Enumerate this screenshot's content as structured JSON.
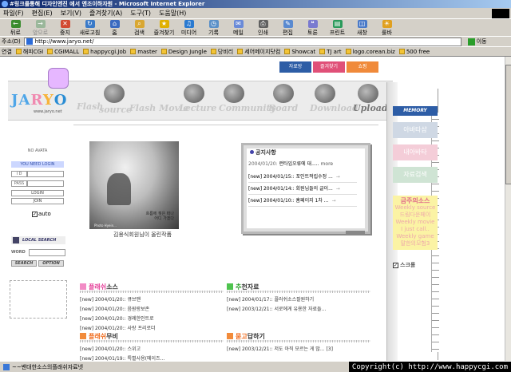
{
  "window": {
    "title": "#링크를통해 디자인엔진 에서 엔조이하자원 - Microsoft Internet Explorer"
  },
  "menu": [
    "파일(F)",
    "편집(E)",
    "보기(V)",
    "즐겨찾기(A)",
    "도구(T)",
    "도움말(H)"
  ],
  "toolbar": [
    {
      "label": "뒤로",
      "color": "#3a8c2e",
      "glyph": "←",
      "icon": "back-arrow-icon"
    },
    {
      "label": "앞으로",
      "color": "#9ab79a",
      "glyph": "→",
      "icon": "forward-arrow-icon",
      "dim": true
    },
    {
      "label": "중지",
      "color": "#d24a32",
      "glyph": "✕",
      "icon": "stop-icon"
    },
    {
      "label": "새로고침",
      "color": "#3a7ac8",
      "glyph": "↻",
      "icon": "refresh-icon"
    },
    {
      "label": "홈",
      "color": "#3a6ac0",
      "glyph": "⌂",
      "icon": "home-icon"
    },
    {
      "label": "검색",
      "color": "#d9a732",
      "glyph": "⌕",
      "icon": "search-icon"
    },
    {
      "label": "즐겨찾기",
      "color": "#e0b000",
      "glyph": "★",
      "icon": "favorites-star-icon"
    },
    {
      "label": "미디어",
      "color": "#2a7ad0",
      "glyph": "♫",
      "icon": "media-icon"
    },
    {
      "label": "기록",
      "color": "#5a90c8",
      "glyph": "◷",
      "icon": "history-icon"
    },
    {
      "label": "메일",
      "color": "#6a8ad8",
      "glyph": "✉",
      "icon": "mail-icon"
    },
    {
      "label": "인쇄",
      "color": "#606060",
      "glyph": "⎙",
      "icon": "print-icon"
    },
    {
      "label": "편집",
      "color": "#5a8ad0",
      "glyph": "✎",
      "icon": "edit-icon"
    },
    {
      "label": "토론",
      "color": "#7a7ad0",
      "glyph": "❝",
      "icon": "discuss-icon"
    },
    {
      "label": "프린트",
      "color": "#2a9a5a",
      "glyph": "▤",
      "icon": "printer-icon"
    },
    {
      "label": "새창",
      "color": "#4a7ac8",
      "glyph": "◫",
      "icon": "new-window-icon"
    },
    {
      "label": "룰바",
      "color": "#e0a020",
      "glyph": "☀",
      "icon": "bulb-icon"
    }
  ],
  "address": {
    "label": "주소(D)",
    "url": "http://www.jaryo.net/",
    "go": "이동"
  },
  "links": {
    "label": "연결",
    "items": [
      "해피CGI",
      "CGIMALL",
      "happycgi.Job",
      "master",
      "Design Jungle",
      "당비리",
      "세어메이지닷컴",
      "Showcat",
      "TJ art",
      "logo.corean.biz",
      "500 free"
    ]
  },
  "top_tabs": [
    {
      "label": "자료방",
      "color": "#2d5da6",
      "strip": "#2d5da6"
    },
    {
      "label": "즐겨찾기",
      "color": "#e05078",
      "strip": "#e05078"
    },
    {
      "label": "쇼핑",
      "color": "#f08a3a",
      "strip": "#f08a3a"
    }
  ],
  "logo": {
    "c1": "JA",
    "c2": "R",
    "c3": "Y",
    "c4": "O",
    "sub": "www.jaryo.net"
  },
  "nav": [
    "Flash",
    "source",
    "Flash Movie",
    "Lecture",
    "Community",
    "Board",
    "Download",
    "Upload"
  ],
  "memory": {
    "head": "MEMORY",
    "buttons": [
      "아바타샵",
      "내아바타",
      "자료검색"
    ],
    "note_title": "금주의소스",
    "note_lines": [
      "Weekly source",
      "드림다운페이",
      "Weekly movie",
      "I just call..",
      "Weekly game",
      "말한의모험3"
    ],
    "scroll_label": "스크롤",
    "scroll_checked": "✓"
  },
  "login": {
    "avatar_caption": "NO AVATA",
    "need_login": "YOU NEED LOGIN",
    "id_label": "I D",
    "pass_label": "PASS",
    "login_btn": "LOGIN",
    "join_btn": "JOIN",
    "auto_label": "auto",
    "auto_checked": "✓"
  },
  "search": {
    "title": "LOCAL SEARCH",
    "word_label": "WORD",
    "search_btn": "SEARCH",
    "option_btn": "OPTION"
  },
  "photo": {
    "caption": "김용식회원님이 올린작품",
    "poem": "흐름에 젖은 떠나\n어디 가겠다",
    "brand": "Photo Hyein..."
  },
  "notice": {
    "title": "공지사항",
    "first_date": "2004/01/20:",
    "first_title": "런타임오류에 대.....",
    "first_more": "more",
    "items": [
      "[new] 2004/01/15:: 포인트적립수정 ...",
      "[new] 2004/01/14:: 회원님들의 글이...",
      "[new] 2004/01/10:: 홈페이지 1차 ..."
    ],
    "go": "→"
  },
  "sections": {
    "flash_source": {
      "title_a": "플래쉬",
      "title_b": "소스",
      "items": [
        "[new] 2004/01/20:: 큐브맨",
        "[new] 2004/01/20:: 음원랑보존",
        "[new] 2004/01/20:: 경례한인트로",
        "[new] 2004/01/20:: 사랑 프리로더"
      ]
    },
    "recommended": {
      "title_a": "추",
      "title_b": "천자료",
      "items": [
        "[new] 2004/01/17:: 플러쉬소스팔원하기",
        "[new] 2003/12/21:: 서로에게 유용한 자료들..."
      ]
    },
    "flash_movie": {
      "title_a": "플래쉬",
      "title_b": "무비",
      "items": [
        "[new] 2004/01/20:: 스위고",
        "[new] 2004/01/19:: 특별사용(메이즈..."
      ]
    },
    "qna": {
      "title_a": "묻고",
      "title_b": "답하기",
      "items": [
        "[new] 2003/12/21:: 저도 아직 모르는 게 많... [3]"
      ]
    }
  },
  "status": {
    "text": "~~밴대한소스의플래쉬자료넷",
    "copyright": "Copyright(c) http://www.happycgi.com"
  }
}
